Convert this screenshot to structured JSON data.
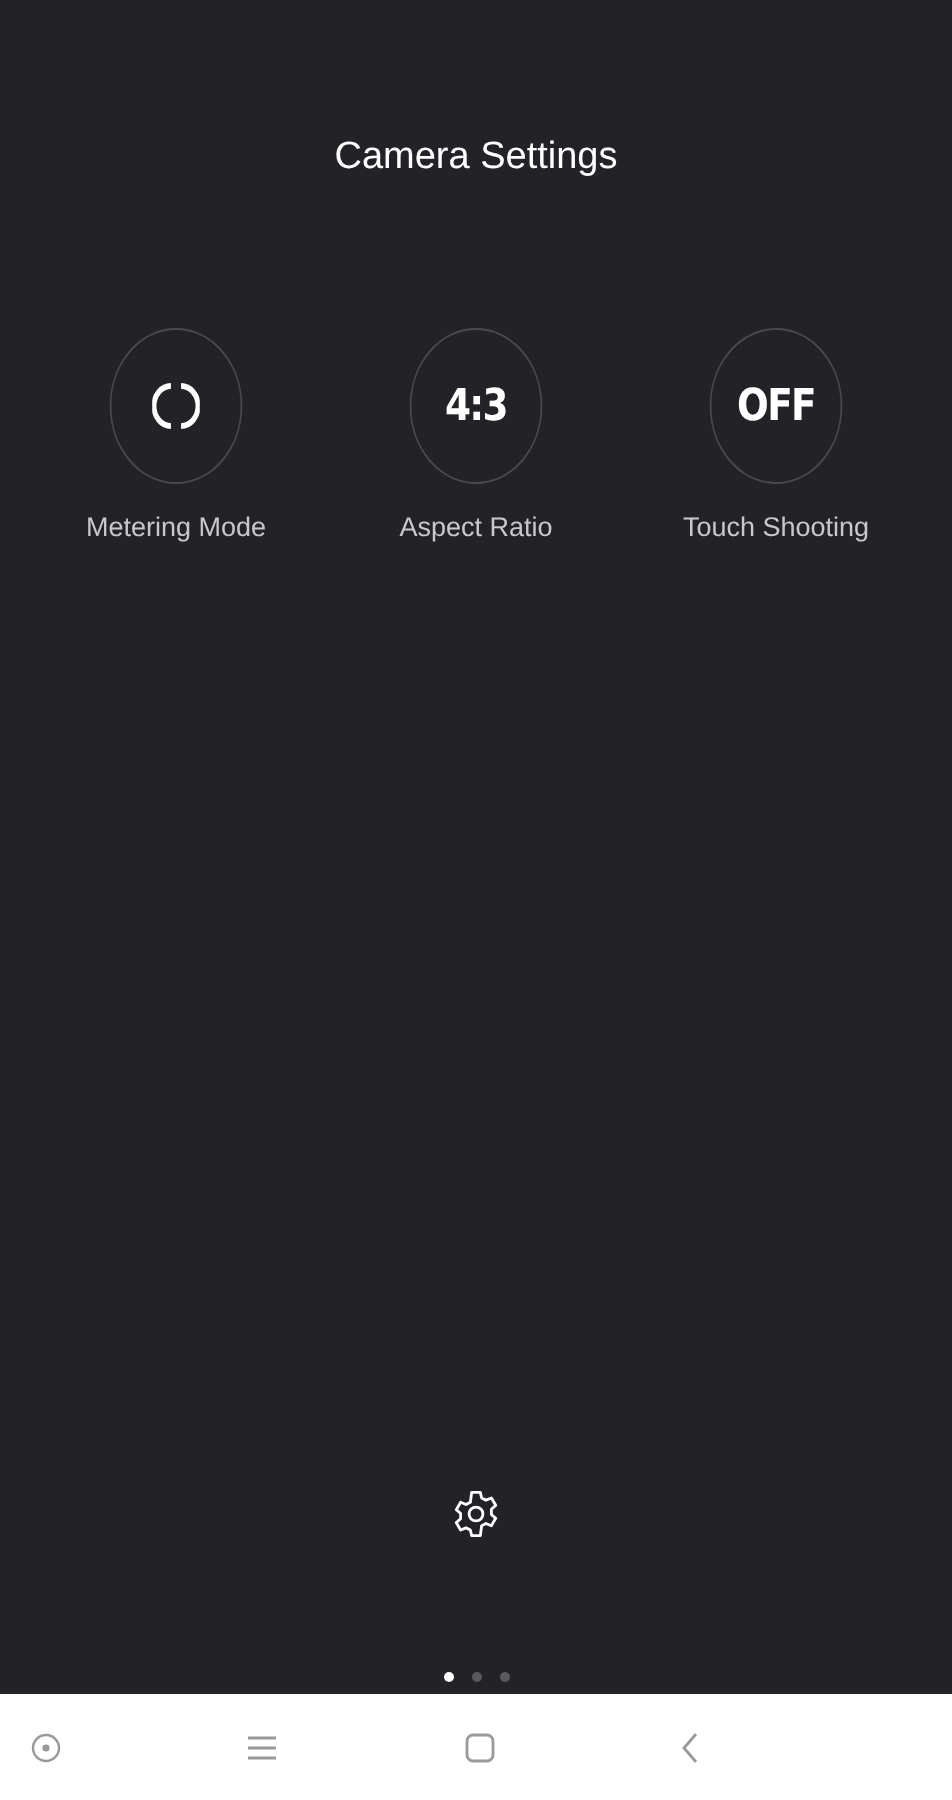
{
  "title": "Camera Settings",
  "options": [
    {
      "kind": "icon",
      "label": "Metering Mode"
    },
    {
      "kind": "text",
      "value": "4:3",
      "label": "Aspect Ratio"
    },
    {
      "kind": "text",
      "value": "OFF",
      "label": "Touch Shooting"
    }
  ],
  "pages": [
    {
      "selected": true
    },
    {
      "selected": false
    },
    {
      "selected": false
    }
  ]
}
